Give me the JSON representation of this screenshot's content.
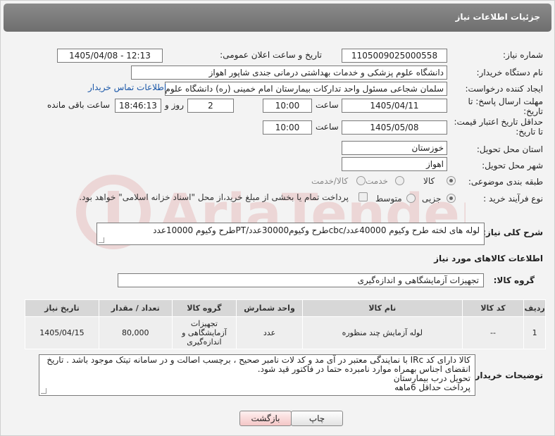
{
  "header": {
    "title": "جزئیات اطلاعات نیاز"
  },
  "form": {
    "need_number": {
      "label": "شماره نیاز:",
      "value": "1105009025000558"
    },
    "announce_datetime": {
      "label": "تاریخ و ساعت اعلان عمومی:",
      "value": "1405/04/08 - 12:13"
    },
    "buyer_org": {
      "label": "نام دستگاه خریدار:",
      "value": "دانشگاه علوم پزشکی و خدمات بهداشتی درمانی جندی شاپور اهواز"
    },
    "requester": {
      "label": "ایجاد کننده درخواست:",
      "value": "سلمان شجاعی مسئول واحد تدارکات بیمارستان امام خمینی (ره) دانشگاه علوم",
      "contact_link": "اطلاعات تماس خریدار"
    },
    "response_deadline": {
      "label_line1": "مهلت ارسال پاسخ: تا",
      "label_line2": "تاریخ:",
      "date": "1405/04/11",
      "time_label": "ساعت",
      "time": "10:00",
      "days": "2",
      "days_label": "روز و",
      "remaining": "18:46:13",
      "remaining_label": "ساعت باقی مانده"
    },
    "price_validity": {
      "label_line1": "حداقل تاریخ اعتبار قیمت:",
      "label_line2": "تا تاریخ:",
      "date": "1405/05/08",
      "time_label": "ساعت",
      "time": "10:00"
    },
    "delivery_province": {
      "label": "استان محل تحویل:",
      "value": "خوزستان"
    },
    "delivery_city": {
      "label": "شهر محل تحویل:",
      "value": "اهواز"
    },
    "category": {
      "label": "طبقه بندی موضوعی:",
      "options": [
        "کالا",
        "خدمت",
        "کالا/خدمت"
      ],
      "selected": "کالا"
    },
    "purchase_process": {
      "label": "نوع فرآیند خرید :",
      "options": [
        "جزیی",
        "متوسط"
      ],
      "selected": "جزیی",
      "payment_note": "پرداخت تمام یا بخشی از مبلغ خرید،از محل \"اسناد خزانه اسلامی\" خواهد بود."
    }
  },
  "summary": {
    "label": "شرح کلی نیاز:",
    "value": "لوله های لخته طرح وکیوم   40000عدد/cbcطرح وکیوم30000عدد/PTطرح وکیوم 10000عدد"
  },
  "goods_info": {
    "title": "اطلاعات کالاهای مورد نیاز",
    "group_label": "گروه کالا:",
    "group_value": "تجهیزات آزمایشگاهی و اندازه‌گیری"
  },
  "table": {
    "headers": [
      "ردیف",
      "کد کالا",
      "نام کالا",
      "واحد شمارش",
      "گروه کالا",
      "تعداد / مقدار",
      "تاریخ نیاز"
    ],
    "rows": [
      [
        "1",
        "--",
        "لوله آزمایش چند منظوره",
        "عدد",
        "تجهیزات آزمایشگاهی و اندازه‌گیری",
        "80,000",
        "1405/04/15"
      ]
    ]
  },
  "buyer_notes": {
    "label": "توضیحات خریدار:",
    "lines": [
      "کالا دارای کد IRc با نمایندگی معتبر در آی مد و کد لات نامبر صحیح ، برچسب اصالت و در سامانه تیتک موجود باشد . تاریخ",
      "انقضای اجناس بهمراه موارد نامبرده حتما در فاکتور قید شود.",
      "تحویل درب بیمارستان",
      "پرداخت حداقل 6ماهه"
    ]
  },
  "buttons": {
    "print": "چاپ",
    "back": "بازگشت"
  },
  "watermark": {
    "text": "AriaTender.neT"
  }
}
